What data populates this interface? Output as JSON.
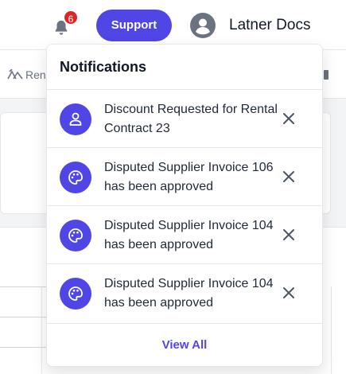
{
  "header": {
    "notification_count": "6",
    "support_label": "Support",
    "user_name": "Latner Docs"
  },
  "background": {
    "tab_label": "Ren"
  },
  "notifications": {
    "title": "Notifications",
    "items": [
      {
        "icon": "user-icon",
        "text": "Discount Requested for Rental Contract 23"
      },
      {
        "icon": "palette-icon",
        "text": "Disputed Supplier Invoice 106 has been approved"
      },
      {
        "icon": "palette-icon",
        "text": "Disputed Supplier Invoice 104 has been approved"
      },
      {
        "icon": "palette-icon",
        "text": "Disputed Supplier Invoice 104 has been approved"
      }
    ],
    "view_all_label": "View All"
  },
  "colors": {
    "accent": "#4f46e5",
    "badge": "#dc2626"
  }
}
